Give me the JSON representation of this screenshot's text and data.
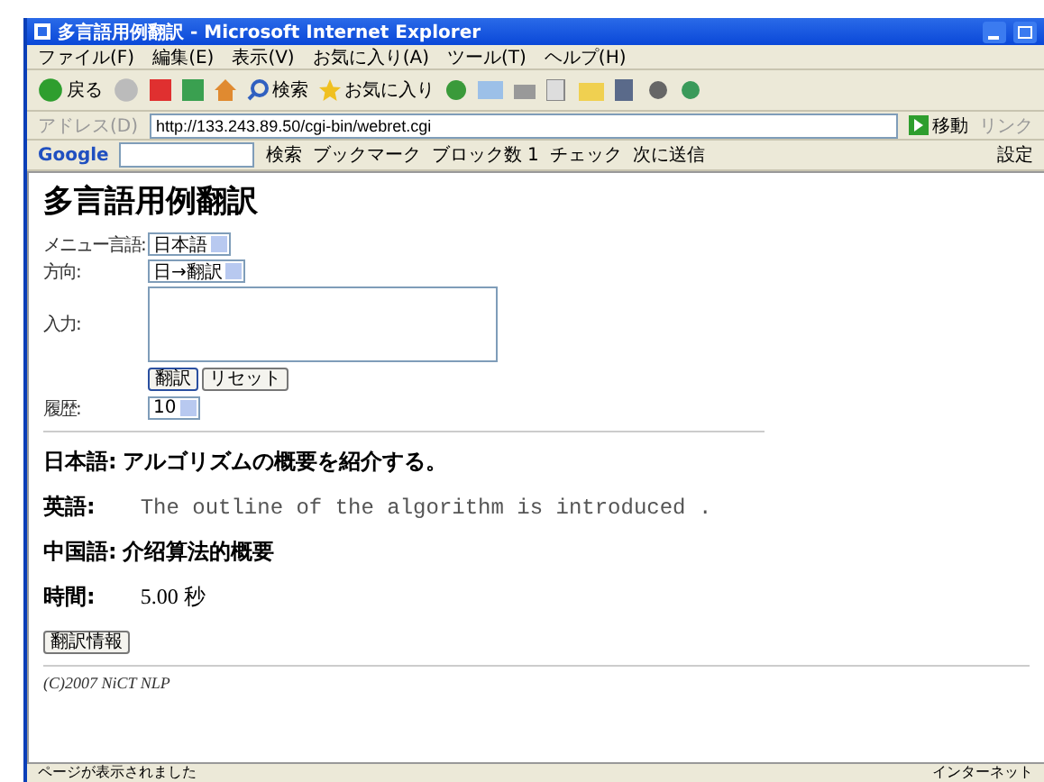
{
  "window": {
    "title": "多言語用例翻訳 - Microsoft Internet Explorer"
  },
  "menu": [
    "ファイル(F)",
    "編集(E)",
    "表示(V)",
    "お気に入り(A)",
    "ツール(T)",
    "ヘルプ(H)"
  ],
  "toolbar": {
    "back": "戻る",
    "search": "検索",
    "favorites": "お気に入り"
  },
  "address": {
    "label": "アドレス(D)",
    "value": "http://133.243.89.50/cgi-bin/webret.cgi",
    "go": "移動",
    "links": "リンク"
  },
  "google_bar": {
    "logo": "Google",
    "items": [
      "検索",
      "ブックマーク",
      "ブロック数 1",
      "チェック",
      "次に送信"
    ],
    "settings": "設定"
  },
  "page": {
    "heading": "多言語用例翻訳",
    "form": [
      {
        "kind": "select",
        "label": "メニュー言語:",
        "value": "日本語"
      },
      {
        "kind": "select",
        "label": "方向:",
        "value": "日→翻訳"
      },
      {
        "kind": "textarea",
        "label": "入力:"
      },
      {
        "kind": "buttons",
        "buttons": [
          {
            "label": "翻訳",
            "focused": true
          },
          {
            "label": "リセット",
            "focused": false
          }
        ]
      },
      {
        "kind": "select",
        "label": "履歴:",
        "value": "10"
      }
    ],
    "results": [
      {
        "label": "日本語:",
        "text": "アルゴリズムの概要を紹介する。",
        "kind": "sentence"
      },
      {
        "label": "英語:",
        "text": "The outline of the algorithm is introduced .",
        "kind": "translation"
      },
      {
        "label": "中国語:",
        "text": "介绍算法的概要",
        "kind": "sentence"
      },
      {
        "label": "時間:",
        "text": "5.00 秒",
        "kind": "time"
      }
    ],
    "info_button": "翻訳情報",
    "footer": "(C)2007 NiCT NLP"
  },
  "status_bar": {
    "message": "ページが表示されました",
    "zone": "インターネット"
  }
}
